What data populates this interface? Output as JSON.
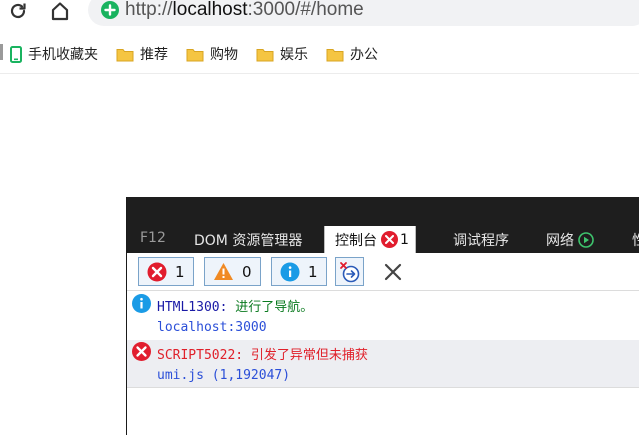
{
  "browser": {
    "url_prefix": "http://",
    "url_host": "localhost",
    "url_rest": ":3000/#/home"
  },
  "bookmarks": [
    {
      "label": "手机收藏夹",
      "icon": "phone-icon"
    },
    {
      "label": "推荐",
      "icon": "folder-icon"
    },
    {
      "label": "购物",
      "icon": "folder-icon"
    },
    {
      "label": "娱乐",
      "icon": "folder-icon"
    },
    {
      "label": "办公",
      "icon": "folder-icon"
    }
  ],
  "devtools": {
    "tabs": {
      "f12": "F12",
      "dom": "DOM 资源管理器",
      "console": "控制台",
      "console_error_count": "1",
      "debugger": "调试程序",
      "network": "网络",
      "cut": "性"
    },
    "filters": {
      "errors": "1",
      "warnings": "0",
      "info": "1"
    },
    "log": {
      "info_code": "HTML1300:",
      "info_message": "进行了导航。",
      "info_source": "localhost:3000",
      "error_code": "SCRIPT5022:",
      "error_message": "引发了异常但未捕获",
      "error_source": "umi.js (1,192047)"
    }
  },
  "colors": {
    "error": "#e11d2e",
    "warning": "#f08a24",
    "info": "#1a9be6",
    "secure": "#19b35f",
    "folder": "#f5c542"
  }
}
